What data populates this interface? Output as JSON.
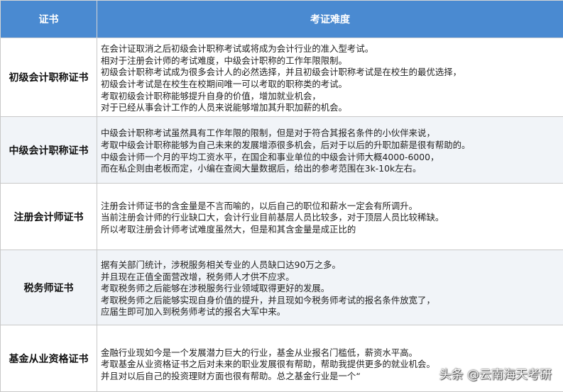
{
  "header": {
    "col1": "证书",
    "col2": "考证难度"
  },
  "rows": [
    {
      "name": "初级会计职称证书",
      "lines": [
        "在会计证取消之后初级会计职称考试或将成为会计行业的准入型考试。",
        "相对于注册会计师的考试难度，中级会计职称的工作年限限制。",
        "初级会计职称考试成为很多会计人的必然选择，并且初级会计职称考试是在校生的最优选择，",
        "初级会计考试是在校生在校期间唯一可以考取的职称类的考试。",
        "考取初级会计职称能够提升自身的价值，增加就业机会，",
        "对于已经从事会计工作的人员来说能够增加其升职加薪的机会。"
      ]
    },
    {
      "name": "中级会计职称证书",
      "lines": [
        "中级会计职称考试虽然具有工作年限的限制，但是对于符合其报名条件的小伙伴来说，",
        "考取中级会计职称能够为自己未来的发展增添很多机会，后对于以后的升职加薪是很有帮助的。",
        "中级会计师一个月的平均工资水平，在国企和事业单位的中级会计师大概4000-6000，",
        "而在私企则由老板而定，小编在查阅大量数据后，给出的参考范围在3k-10k左右。"
      ]
    },
    {
      "name": "注册会计师证书",
      "lines": [
        "注册会计师证书的含金量是不言而喻的，以后自己的职位和薪水一定会有所调升。",
        "当前注册会计师的行业缺口大，会计行业目前基层人员比较多，对于顶层人员比较稀缺。",
        "所以考取注册会计师考试难度虽然大，但是和其含金量是成正比的"
      ]
    },
    {
      "name": "税务师证书",
      "lines": [
        "据有关部门统计，涉税服务相关专业的人员缺口达90万之多。",
        "并且现在正值全面营改增，税务师人才供不应求。",
        "考取税务师之后能够在涉税服务行业领域取得更好的发展。",
        "考取税务师之后能够实现自身价值的提升，并且现如今税务师考试的报名条件放宽了，",
        "应届生即可加入到税务师考试的报名大军中来。"
      ]
    },
    {
      "name": "基金从业资格证书",
      "lines": [
        "金融行业现如今是一个发展潜力巨大的行业，基金从业报名门槛低，薪资水平高。",
        "考取基金从业资格证书之后对未来的职业发展很有帮助，帮助我提供更多的就业机会。",
        "并且对以后自己的投资理财方面也很有帮助。总之基金行业是一个“"
      ]
    }
  ],
  "watermark": "头条 @云南海天考研"
}
